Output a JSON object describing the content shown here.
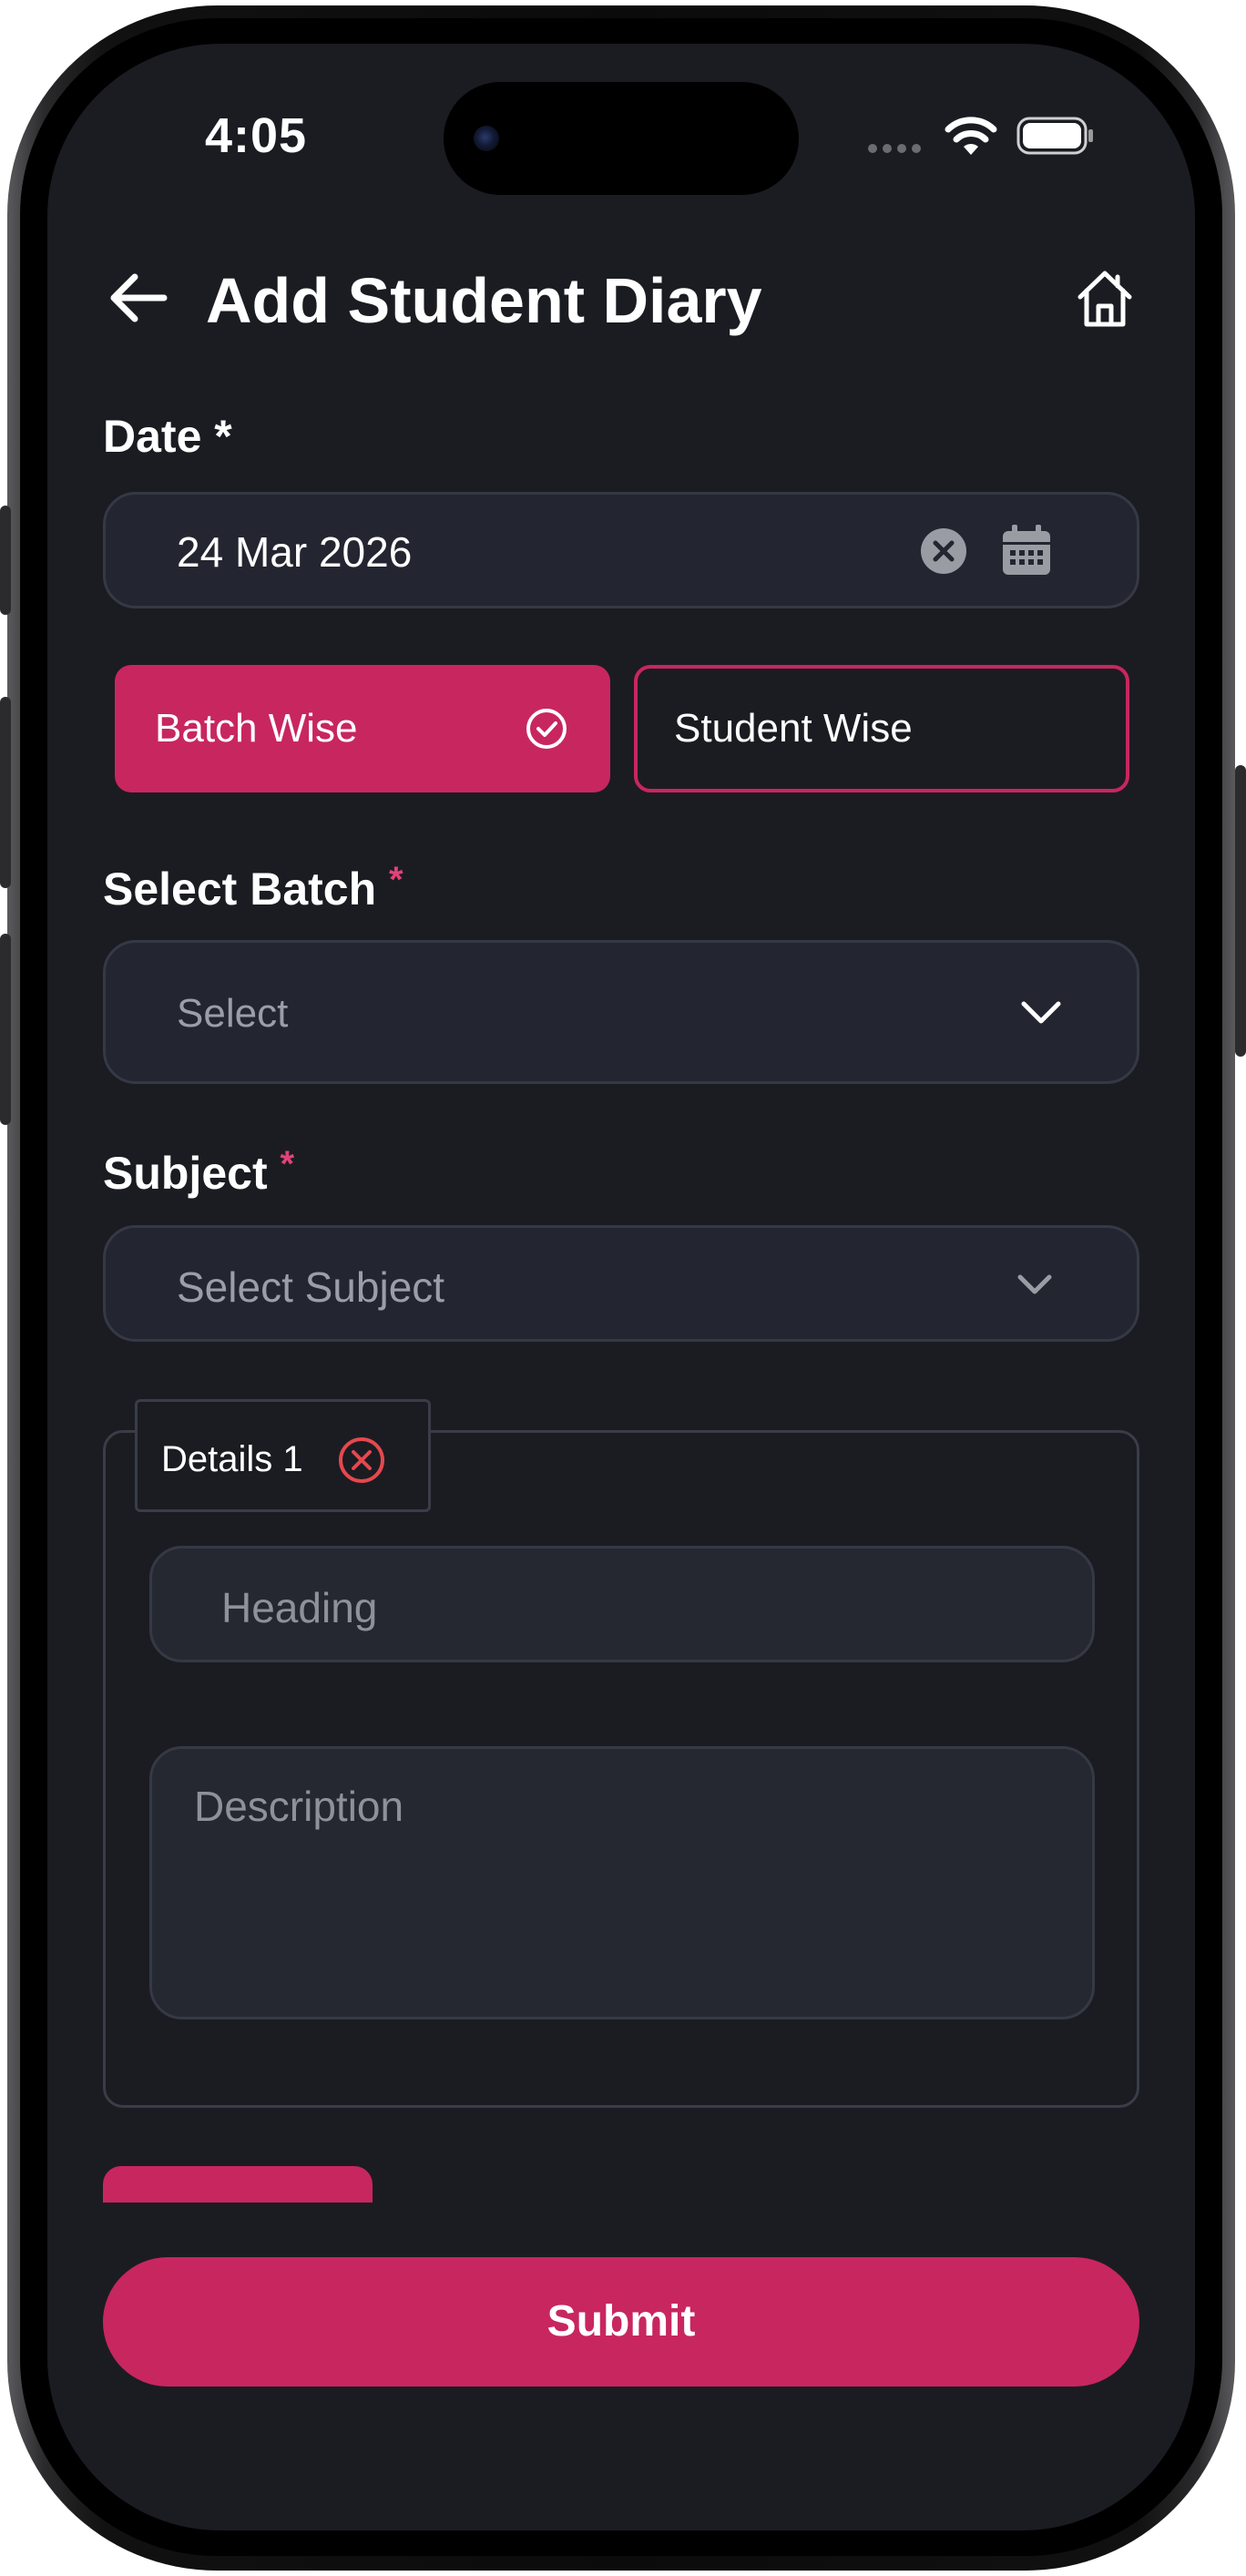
{
  "status_bar": {
    "time": "4:05"
  },
  "header": {
    "title": "Add Student Diary"
  },
  "date_field": {
    "label": "Date",
    "required_mark": "*",
    "value": "24 Mar 2026"
  },
  "mode_tabs": [
    {
      "label": "Batch Wise",
      "selected": true
    },
    {
      "label": "Student Wise",
      "selected": false
    }
  ],
  "batch": {
    "label": "Select Batch",
    "required_mark": "*",
    "placeholder": "Select"
  },
  "subject": {
    "label": "Subject",
    "required_mark": "*",
    "placeholder": "Select Subject"
  },
  "details": {
    "tab_label": "Details 1",
    "heading_placeholder": "Heading",
    "description_placeholder": "Description"
  },
  "submit_label": "Submit",
  "colors": {
    "background": "#1b1c22",
    "accent": "#c8265f",
    "field_bg": "#232630",
    "required": "#e04377",
    "remove_icon": "#e5484d"
  },
  "icons": [
    "back-arrow-icon",
    "home-icon",
    "clear-icon",
    "calendar-icon",
    "check-circle-icon",
    "chevron-down-icon",
    "remove-circle-icon",
    "wifi-icon",
    "battery-icon",
    "signal-icon"
  ]
}
